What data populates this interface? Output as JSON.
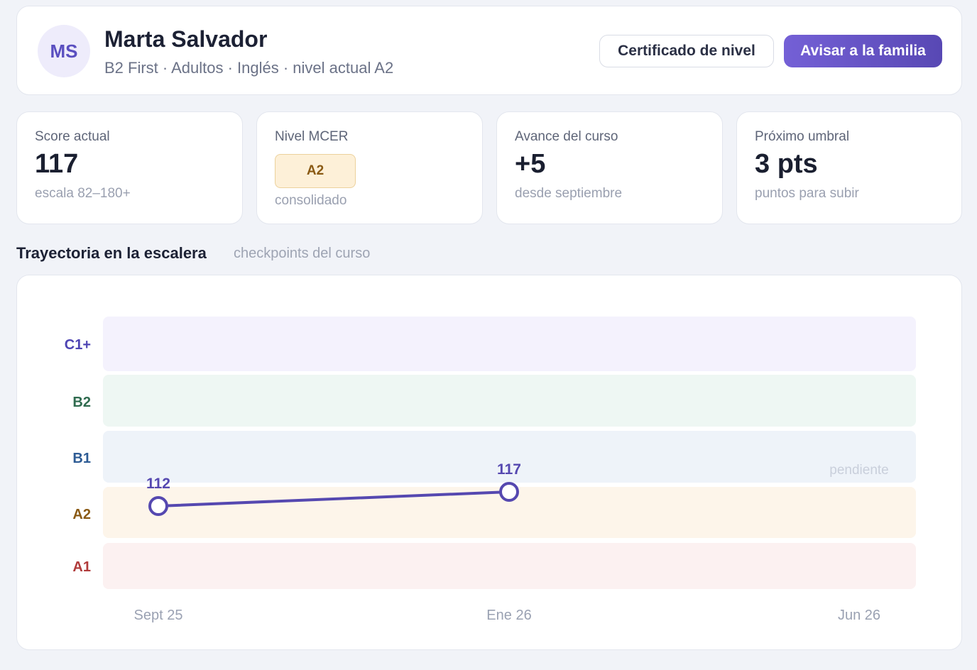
{
  "profile": {
    "initials": "MS",
    "name": "Marta Salvador",
    "subtitle": "B2 First · Adultos · Inglés · nivel actual A2"
  },
  "actions": {
    "certificate_label": "Certificado de nivel",
    "notify_label": "Avisar a la familia"
  },
  "stats": {
    "score": {
      "label": "Score actual",
      "value": "117",
      "sub": "escala 82–180+"
    },
    "level": {
      "label": "Nivel MCER",
      "value": "A2",
      "sub": "consolidado"
    },
    "progress": {
      "label": "Avance del curso",
      "value": "+5",
      "sub": "desde septiembre"
    },
    "threshold": {
      "label": "Próximo umbral",
      "value": "3 pts",
      "sub": "puntos para subir"
    }
  },
  "section": {
    "title": "Trayectoria en la escalera",
    "subtitle": "checkpoints del curso"
  },
  "colors": {
    "accent": "#5548b0",
    "band_c1": "#f4f2fd",
    "band_b2": "#eef7f3",
    "band_b1": "#eef3f9",
    "band_a2": "#fdf5ea",
    "band_a1": "#fcf1f1",
    "label_c1": "#4e44b3",
    "label_b2": "#2f6b4f",
    "label_b1": "#2d5b94",
    "label_a2": "#8a5a14",
    "label_a1": "#b03b3b"
  },
  "chart_data": {
    "type": "line",
    "x": [
      "Sept 25",
      "Ene 26",
      "Jun 26"
    ],
    "series": [
      {
        "values": [
          112,
          117,
          null
        ]
      }
    ],
    "data_labels": [
      "112",
      "117"
    ],
    "pending_label": "pendiente",
    "bands": [
      {
        "label": "C1+",
        "min": 180,
        "max": 200
      },
      {
        "label": "B2",
        "min": 160,
        "max": 180
      },
      {
        "label": "B1",
        "min": 140,
        "max": 160
      },
      {
        "label": "A2",
        "min": 120,
        "max": 140
      },
      {
        "label": "A1",
        "min": 100,
        "max": 120
      }
    ]
  }
}
